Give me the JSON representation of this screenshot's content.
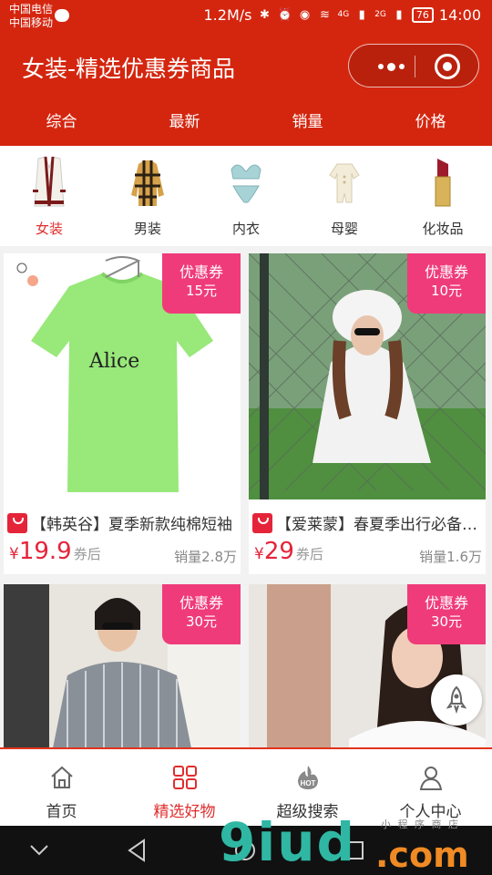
{
  "status_bar": {
    "carrier_1": "中国电信",
    "carrier_2": "中国移动",
    "speed": "1.2M/s",
    "net_4g": "4G",
    "net_2g": "2G",
    "battery": "76",
    "time": "14:00"
  },
  "header": {
    "title": "女装-精选优惠券商品"
  },
  "sort_tabs": [
    "综合",
    "最新",
    "销量",
    "价格"
  ],
  "categories": [
    {
      "label": "女装",
      "icon": "cardigan-icon",
      "active": true
    },
    {
      "label": "男装",
      "icon": "plaid-shirt-icon",
      "active": false
    },
    {
      "label": "内衣",
      "icon": "lingerie-icon",
      "active": false
    },
    {
      "label": "母婴",
      "icon": "baby-romper-icon",
      "active": false
    },
    {
      "label": "化妆品",
      "icon": "lipstick-icon",
      "active": false
    }
  ],
  "coupon_label": "优惠券",
  "products": [
    {
      "name": "【韩英谷】夏季新款纯棉短袖",
      "price_symbol": "¥",
      "price": "19.9",
      "price_suffix": "券后",
      "sales": "销量2.8万",
      "coupon": "15元",
      "print_text": "Alice"
    },
    {
      "name": "【爱莱蒙】春夏季出行必备防晒衣",
      "price_symbol": "¥",
      "price": "29",
      "price_suffix": "券后",
      "sales": "销量1.6万",
      "coupon": "10元"
    },
    {
      "name": "",
      "coupon": "30元"
    },
    {
      "name": "",
      "coupon": "30元"
    }
  ],
  "tabbar": [
    {
      "label": "首页",
      "icon": "home-icon",
      "active": false
    },
    {
      "label": "精选好物",
      "icon": "grid-icon",
      "active": true
    },
    {
      "label": "超级搜索",
      "icon": "hot-fire-icon",
      "badge": "HOT",
      "active": false
    },
    {
      "label": "个人中心",
      "icon": "user-icon",
      "active": false
    }
  ],
  "watermark": {
    "logo": "9iud",
    "domain": ".com",
    "small": "小 程 序 商 店"
  },
  "colors": {
    "brand_red": "#d4260f",
    "coupon_pink": "#ef3b7a",
    "price_red": "#e5243a",
    "active_text": "#e02e2e"
  }
}
